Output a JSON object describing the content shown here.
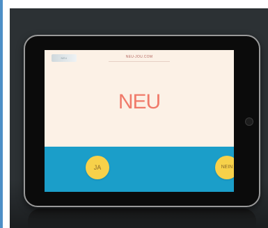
{
  "screen": {
    "logo_text": "NEU",
    "url_text": "NEU-JOU.COM",
    "headline": "NEU"
  },
  "buttons": {
    "yes_label": "JA",
    "no_label": "NEIN"
  },
  "colors": {
    "screen_background": "#fcf1e6",
    "water": "#1b9ec9",
    "headline": "#f07a6a",
    "button": "#f7d14a",
    "stage": "#2c3134"
  }
}
